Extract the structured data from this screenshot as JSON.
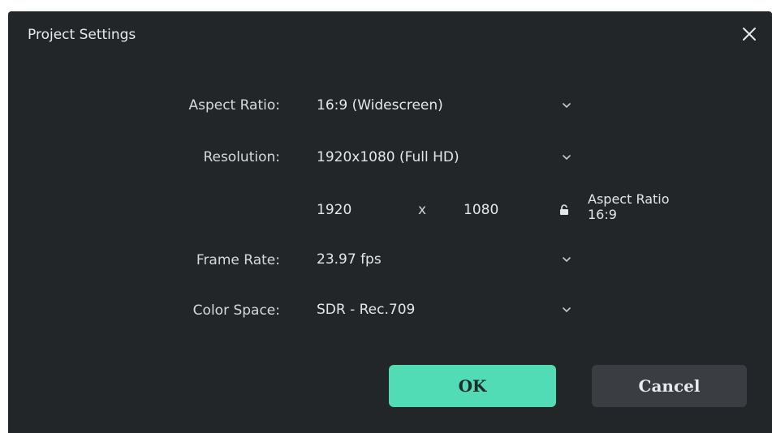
{
  "dialog": {
    "title": "Project Settings",
    "close_icon": "close-icon"
  },
  "aspect_ratio": {
    "label": "Aspect Ratio:",
    "value": "16:9 (Widescreen)"
  },
  "resolution": {
    "label": "Resolution:",
    "value": "1920x1080 (Full HD)",
    "width": "1920",
    "separator": "x",
    "height": "1080",
    "lock_icon": "lock-icon",
    "aspect_note_line1": "Aspect Ratio",
    "aspect_note_line2": "16:9"
  },
  "frame_rate": {
    "label": "Frame Rate:",
    "value": "23.97 fps"
  },
  "color_space": {
    "label": "Color Space:",
    "value": "SDR - Rec.709"
  },
  "buttons": {
    "ok": "OK",
    "cancel": "Cancel"
  },
  "colors": {
    "dialog_bg": "#232629",
    "ok_button": "#52dcb6",
    "cancel_button": "#3a3e42"
  }
}
